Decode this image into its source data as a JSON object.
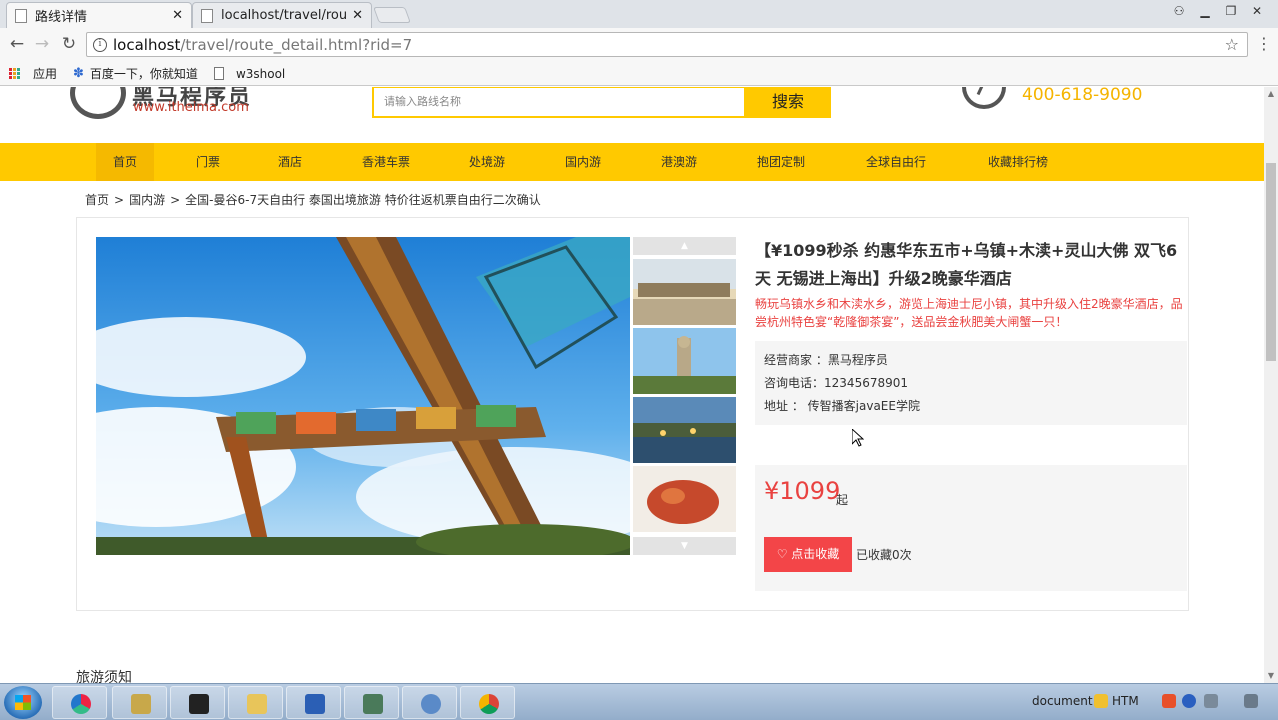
{
  "browser": {
    "tabs": [
      {
        "title": "路线详情",
        "active": true
      },
      {
        "title": "localhost/travel/route/",
        "active": false
      }
    ],
    "url_host": "localhost",
    "url_path": "/travel/route_detail.html?rid=7",
    "bookmarks": [
      {
        "label": "应用",
        "icon": "apps-icon"
      },
      {
        "label": "百度一下，你就知道",
        "icon": "paw-icon"
      },
      {
        "label": "w3shool",
        "icon": "page-icon"
      }
    ]
  },
  "header": {
    "logo_text": "黑马程序员",
    "logo_url": "www.itheima.com",
    "search_placeholder": "请输入路线名称",
    "search_button": "搜索",
    "hotline": "400-618-9090"
  },
  "nav": {
    "items": [
      "首页",
      "门票",
      "酒店",
      "香港车票",
      "处境游",
      "国内游",
      "港澳游",
      "抱团定制",
      "全球自由行",
      "收藏排行榜"
    ],
    "current": "首页"
  },
  "breadcrumb": {
    "items": [
      "首页",
      "国内游",
      "全国-曼谷6-7天自由行 泰国出境旅游 特价往返机票自由行二次确认"
    ],
    "separator": ">"
  },
  "route": {
    "title": "【¥1099秒杀 约惠华东五市+乌镇+木渎+灵山大佛 双飞6天 无锡进上海出】升级2晚豪华酒店",
    "subtitle": "畅玩乌镇水乡和木渎水乡，游览上海迪士尼小镇，其中升级入住2晚豪华酒店，品尝杭州特色宴“乾隆御茶宴”，送品尝金秋肥美大闸蟹一只！",
    "merchant_label": "经营商家",
    "merchant": "黑马程序员",
    "phone_label": "咨询电话",
    "phone": "12345678901",
    "address_label": "地址",
    "address": "传智播客javaEE学院",
    "price": "¥1099",
    "price_suffix": "起",
    "favorite_button": "点击收藏",
    "favorite_count": "已收藏0次"
  },
  "tips_title": "旅游须知",
  "colors": {
    "accent": "#ffc900",
    "price": "#e94240",
    "fav_button": "#f34548"
  },
  "taskbar": {
    "tray_text_1": "document",
    "tray_text_2": "HTM"
  }
}
